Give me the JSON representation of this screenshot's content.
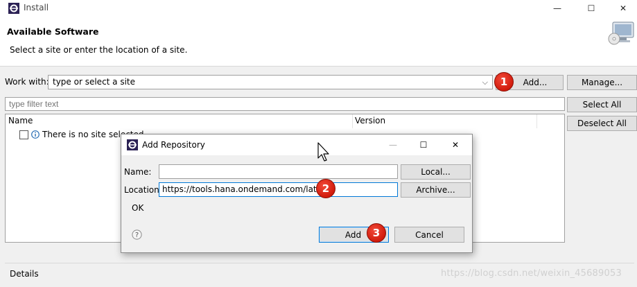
{
  "window": {
    "title": "Install",
    "controls": {
      "minimize": "—",
      "maximize": "☐",
      "close": "✕"
    }
  },
  "header": {
    "title": "Available Software",
    "subtitle": "Select a site or enter the location of a site."
  },
  "work_with": {
    "label": "Work with:",
    "value": "type or select a site",
    "add_button": "Add...",
    "manage_button": "Manage..."
  },
  "filter": {
    "placeholder": "type filter text"
  },
  "side_buttons": {
    "select_all": "Select All",
    "deselect_all": "Deselect All"
  },
  "tree": {
    "columns": [
      "Name",
      "Version"
    ],
    "rows": [
      {
        "label": "There is no site selected."
      }
    ]
  },
  "details_label": "Details",
  "watermark": "https://blog.csdn.net/weixin_45689053",
  "badges": [
    "1",
    "2",
    "3"
  ],
  "dialog": {
    "title": "Add Repository",
    "name_label": "Name:",
    "name_value": "",
    "location_label": "Location:",
    "location_value": "https://tools.hana.ondemand.com/latest",
    "local_button": "Local...",
    "archive_button": "Archive...",
    "status_text": "OK",
    "add_button": "Add",
    "cancel_button": "Cancel",
    "controls": {
      "minimize": "—",
      "maximize": "☐",
      "close": "✕"
    }
  },
  "colors": {
    "badge": "#d11b0c",
    "focus_border": "#0078d7",
    "button_face": "#e1e1e1",
    "window_bg": "#f0f0f0"
  }
}
